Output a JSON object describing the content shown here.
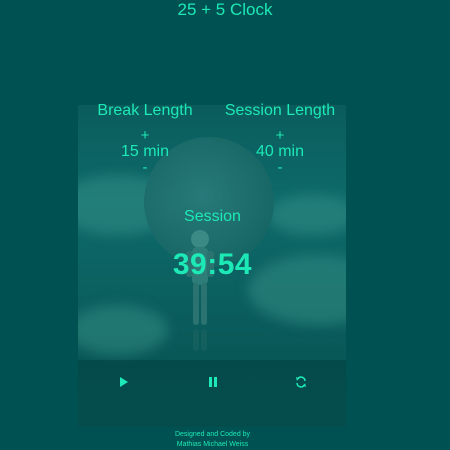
{
  "app": {
    "title": "25 + 5 Clock"
  },
  "break": {
    "label": "Break Length",
    "increment": "+",
    "value": "15 min",
    "decrement": "-"
  },
  "session": {
    "label": "Session Length",
    "increment": "+",
    "value": "40 min",
    "decrement": "-"
  },
  "timer": {
    "label": "Session",
    "time": "39:54"
  },
  "controls": {
    "play_icon": "play-icon",
    "pause_icon": "pause-icon",
    "reset_icon": "refresh-icon"
  },
  "footer": {
    "line1": "Designed and Coded by",
    "line2": "Mathias Michael Weiss"
  },
  "colors": {
    "background": "#005151",
    "accent": "#1de9b6"
  }
}
